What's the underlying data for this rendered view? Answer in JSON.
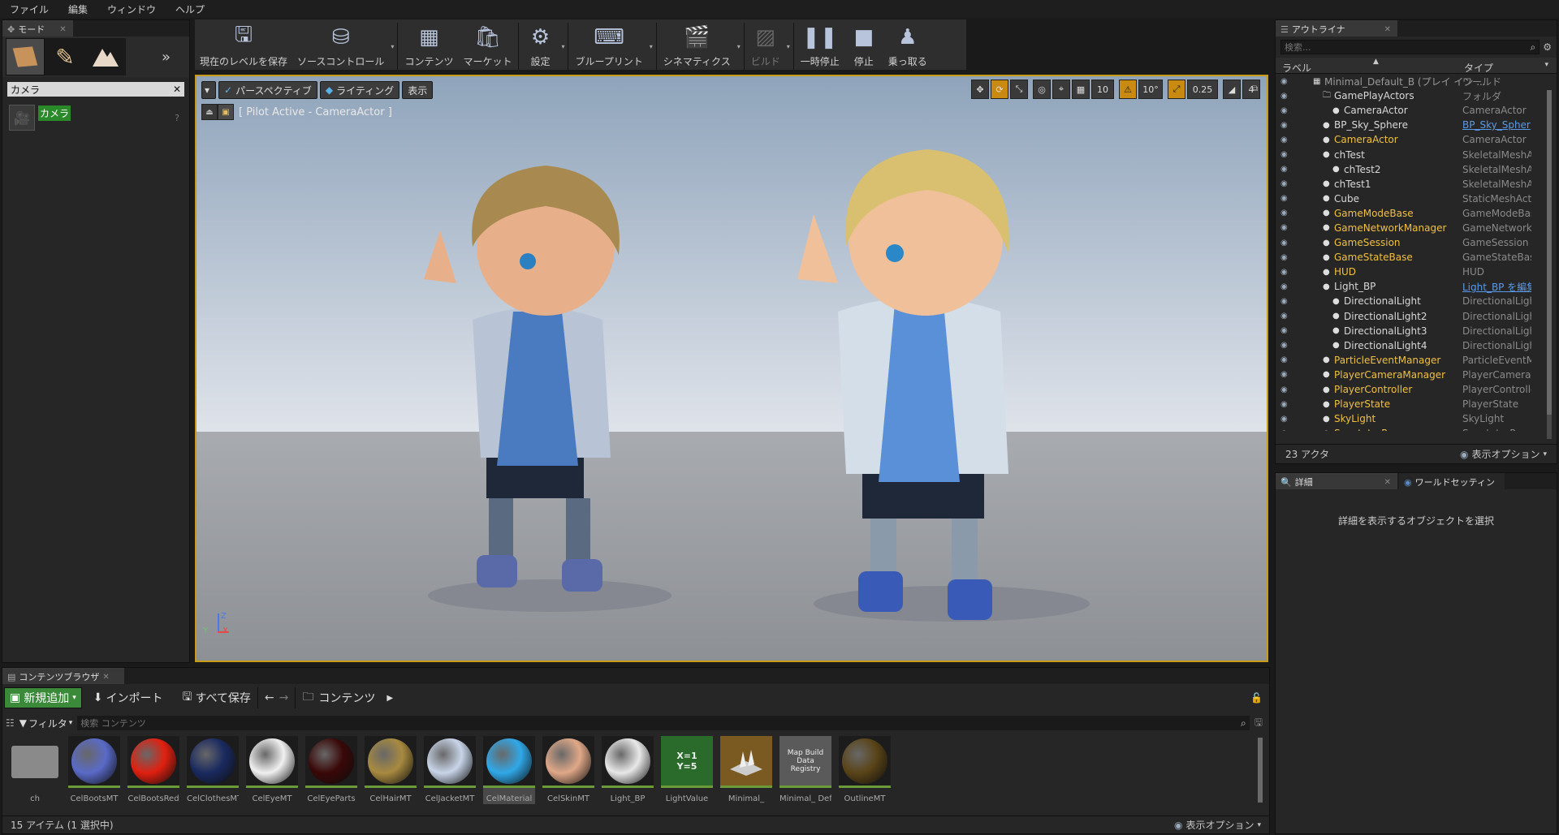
{
  "menu": [
    "ファイル",
    "編集",
    "ウィンドウ",
    "ヘルプ"
  ],
  "modes": {
    "tab": "モード",
    "search_value": "カメラ",
    "result": "カメラ"
  },
  "toolbar": [
    {
      "label": "現在のレベルを保存",
      "icon": "save-icon"
    },
    {
      "label": "ソースコントロール",
      "icon": "source-control-icon"
    },
    {
      "label": "コンテンツ",
      "icon": "content-icon"
    },
    {
      "label": "マーケット",
      "icon": "market-icon"
    },
    {
      "label": "設定",
      "icon": "settings-icon"
    },
    {
      "label": "ブループリント",
      "icon": "blueprint-icon"
    },
    {
      "label": "シネマティクス",
      "icon": "cinematics-icon"
    },
    {
      "label": "ビルド",
      "icon": "build-icon"
    },
    {
      "label": "一時停止",
      "icon": "pause-icon"
    },
    {
      "label": "停止",
      "icon": "stop-icon"
    },
    {
      "label": "乗っ取る",
      "icon": "possess-icon"
    }
  ],
  "viewport": {
    "perspective": "パースペクティブ",
    "lighting": "ライティング",
    "show": "表示",
    "pilot": "[ Pilot Active - CameraActor ]",
    "grid": "10",
    "angle": "10°",
    "scale": "0.25",
    "speed": "4",
    "axis_z": "Z",
    "axis_x": "X",
    "axis_y": "Y"
  },
  "outliner": {
    "tab": "アウトライナ",
    "search_placeholder": "検索...",
    "col_label": "ラベル",
    "col_type": "タイプ",
    "count": "23 アクタ",
    "view_options": "表示オプション",
    "rows": [
      {
        "label": "Minimal_Default_B (プレイ イン ...",
        "type": "ワールド",
        "indent": 0,
        "color": "#9a9a9a"
      },
      {
        "label": "GamePlayActors",
        "type": "フォルダ",
        "indent": 1,
        "color": "#d8d8d8"
      },
      {
        "label": "CameraActor",
        "type": "CameraActor",
        "indent": 2,
        "color": "#d8d8d8"
      },
      {
        "label": "BP_Sky_Sphere",
        "type": "BP_Sky_Spher",
        "indent": 1,
        "color": "#d8d8d8",
        "link": true
      },
      {
        "label": "CameraActor",
        "type": "CameraActor",
        "indent": 1,
        "color": "#f0c040"
      },
      {
        "label": "chTest",
        "type": "SkeletalMeshAct",
        "indent": 1,
        "color": "#d8d8d8"
      },
      {
        "label": "chTest2",
        "type": "SkeletalMeshAct",
        "indent": 2,
        "color": "#d8d8d8"
      },
      {
        "label": "chTest1",
        "type": "SkeletalMeshAct",
        "indent": 1,
        "color": "#d8d8d8"
      },
      {
        "label": "Cube",
        "type": "StaticMeshActor",
        "indent": 1,
        "color": "#d8d8d8"
      },
      {
        "label": "GameModeBase",
        "type": "GameModeBase",
        "indent": 1,
        "color": "#f0c040"
      },
      {
        "label": "GameNetworkManager",
        "type": "GameNetworkMa",
        "indent": 1,
        "color": "#f0c040"
      },
      {
        "label": "GameSession",
        "type": "GameSession",
        "indent": 1,
        "color": "#f0c040"
      },
      {
        "label": "GameStateBase",
        "type": "GameStateBase",
        "indent": 1,
        "color": "#f0c040"
      },
      {
        "label": "HUD",
        "type": "HUD",
        "indent": 1,
        "color": "#f0c040"
      },
      {
        "label": "Light_BP",
        "type": "Light_BP を編集",
        "indent": 1,
        "color": "#d8d8d8",
        "link": true
      },
      {
        "label": "DirectionalLight",
        "type": "DirectionalLight",
        "indent": 2,
        "color": "#d8d8d8"
      },
      {
        "label": "DirectionalLight2",
        "type": "DirectionalLight",
        "indent": 2,
        "color": "#d8d8d8"
      },
      {
        "label": "DirectionalLight3",
        "type": "DirectionalLight",
        "indent": 2,
        "color": "#d8d8d8"
      },
      {
        "label": "DirectionalLight4",
        "type": "DirectionalLight",
        "indent": 2,
        "color": "#d8d8d8"
      },
      {
        "label": "ParticleEventManager",
        "type": "ParticleEventMa",
        "indent": 1,
        "color": "#f0c040"
      },
      {
        "label": "PlayerCameraManager",
        "type": "PlayerCameraM",
        "indent": 1,
        "color": "#f0c040"
      },
      {
        "label": "PlayerController",
        "type": "PlayerController",
        "indent": 1,
        "color": "#f0c040"
      },
      {
        "label": "PlayerState",
        "type": "PlayerState",
        "indent": 1,
        "color": "#f0c040"
      },
      {
        "label": "SkyLight",
        "type": "SkyLight",
        "indent": 1,
        "color": "#f0c040"
      },
      {
        "label": "SpectatorPawn",
        "type": "SpectatorPawn",
        "indent": 1,
        "color": "#f0c040"
      }
    ]
  },
  "details": {
    "tab": "詳細",
    "tab2": "ワールドセッティン",
    "empty": "詳細を表示するオブジェクトを選択"
  },
  "content": {
    "tab": "コンテンツブラウザ",
    "add_new": "新規追加",
    "import": "インポート",
    "save_all": "すべて保存",
    "path": "コンテンツ",
    "filter": "フィルタ",
    "search_placeholder": "検索 コンテンツ",
    "status": "15 アイテム (1 選択中)",
    "view_options": "表示オプション",
    "assets": [
      {
        "name": "ch",
        "kind": "folder"
      },
      {
        "name": "CelBootsMT",
        "kind": "sphere",
        "color": "#5a6ac8"
      },
      {
        "name": "CelBootsRed",
        "kind": "sphere",
        "color": "#e02010"
      },
      {
        "name": "CelClothesMT",
        "kind": "sphere",
        "color": "#1a2a60"
      },
      {
        "name": "CelEyeMT",
        "kind": "sphere",
        "color": "#f0f0f0"
      },
      {
        "name": "CelEyeParts",
        "kind": "sphere",
        "color": "#3a0808"
      },
      {
        "name": "CelHairMT",
        "kind": "sphere",
        "color": "#a88a40"
      },
      {
        "name": "CelJacketMT",
        "kind": "sphere",
        "color": "#c8d4e8"
      },
      {
        "name": "CelMaterial",
        "kind": "sphere",
        "color": "#30a8e8"
      },
      {
        "name": "CelSkinMT",
        "kind": "sphere",
        "color": "#e0a888"
      },
      {
        "name": "Light_BP",
        "kind": "sphere",
        "color": "#e8e8e8"
      },
      {
        "name": "LightValue",
        "kind": "text",
        "text": "X=1 Y=5"
      },
      {
        "name": "Minimal_",
        "kind": "level"
      },
      {
        "name": "Minimal_ Default_B",
        "kind": "registry",
        "text": "Map Build Data Registry"
      },
      {
        "name": "OutlineMT",
        "kind": "sphere",
        "color": "#5a4418"
      }
    ]
  }
}
